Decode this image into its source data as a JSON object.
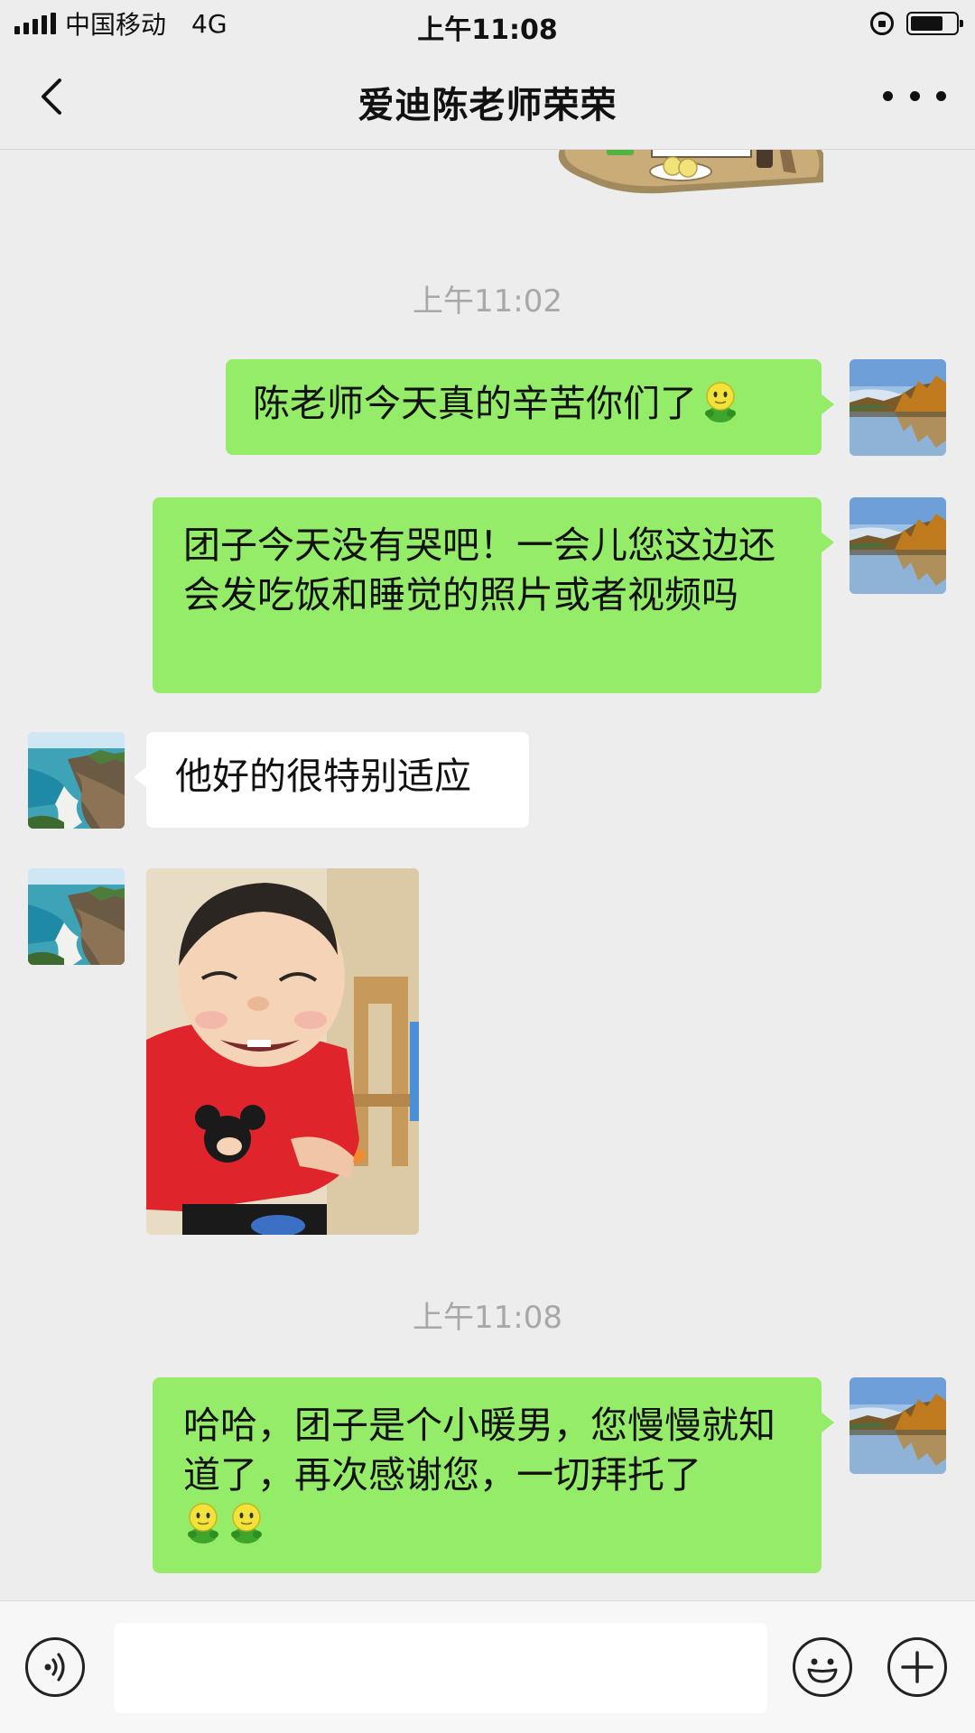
{
  "status_bar": {
    "carrier": "中国移动",
    "network": "4G",
    "time": "上午11:08",
    "battery_level": 0.75
  },
  "nav": {
    "title": "爱迪陈老师荣荣",
    "back_icon": "chevron-left-icon",
    "more_icon": "more-dots-icon"
  },
  "messages": [
    {
      "type": "timestamp",
      "text": "上午11:02"
    },
    {
      "type": "text",
      "direction": "out",
      "text": "陈老师今天真的辛苦你们了",
      "emoji_count": 1
    },
    {
      "type": "text",
      "direction": "out",
      "text": "团子今天没有哭吧！一会儿您这边还会发吃饭和睡觉的照片或者视频吗"
    },
    {
      "type": "text",
      "direction": "in",
      "text": "他好的很特别适应"
    },
    {
      "type": "image",
      "direction": "in",
      "description_icon": "photo-image"
    },
    {
      "type": "timestamp",
      "text": "上午11:08"
    },
    {
      "type": "text",
      "direction": "out",
      "text": "哈哈，团子是个小暖男，您慢慢就知道了，再次感谢您，一切拜托了",
      "emoji_count": 2
    }
  ],
  "input_bar": {
    "voice_icon": "voice-icon",
    "emoji_icon": "emoji-smile-icon",
    "plus_icon": "plus-circle-icon",
    "placeholder": ""
  },
  "colors": {
    "background": "#EDEDED",
    "outgoing_bubble": "#95EC69",
    "incoming_bubble": "#FFFFFF",
    "timestamp_text": "#A8A8A8"
  }
}
